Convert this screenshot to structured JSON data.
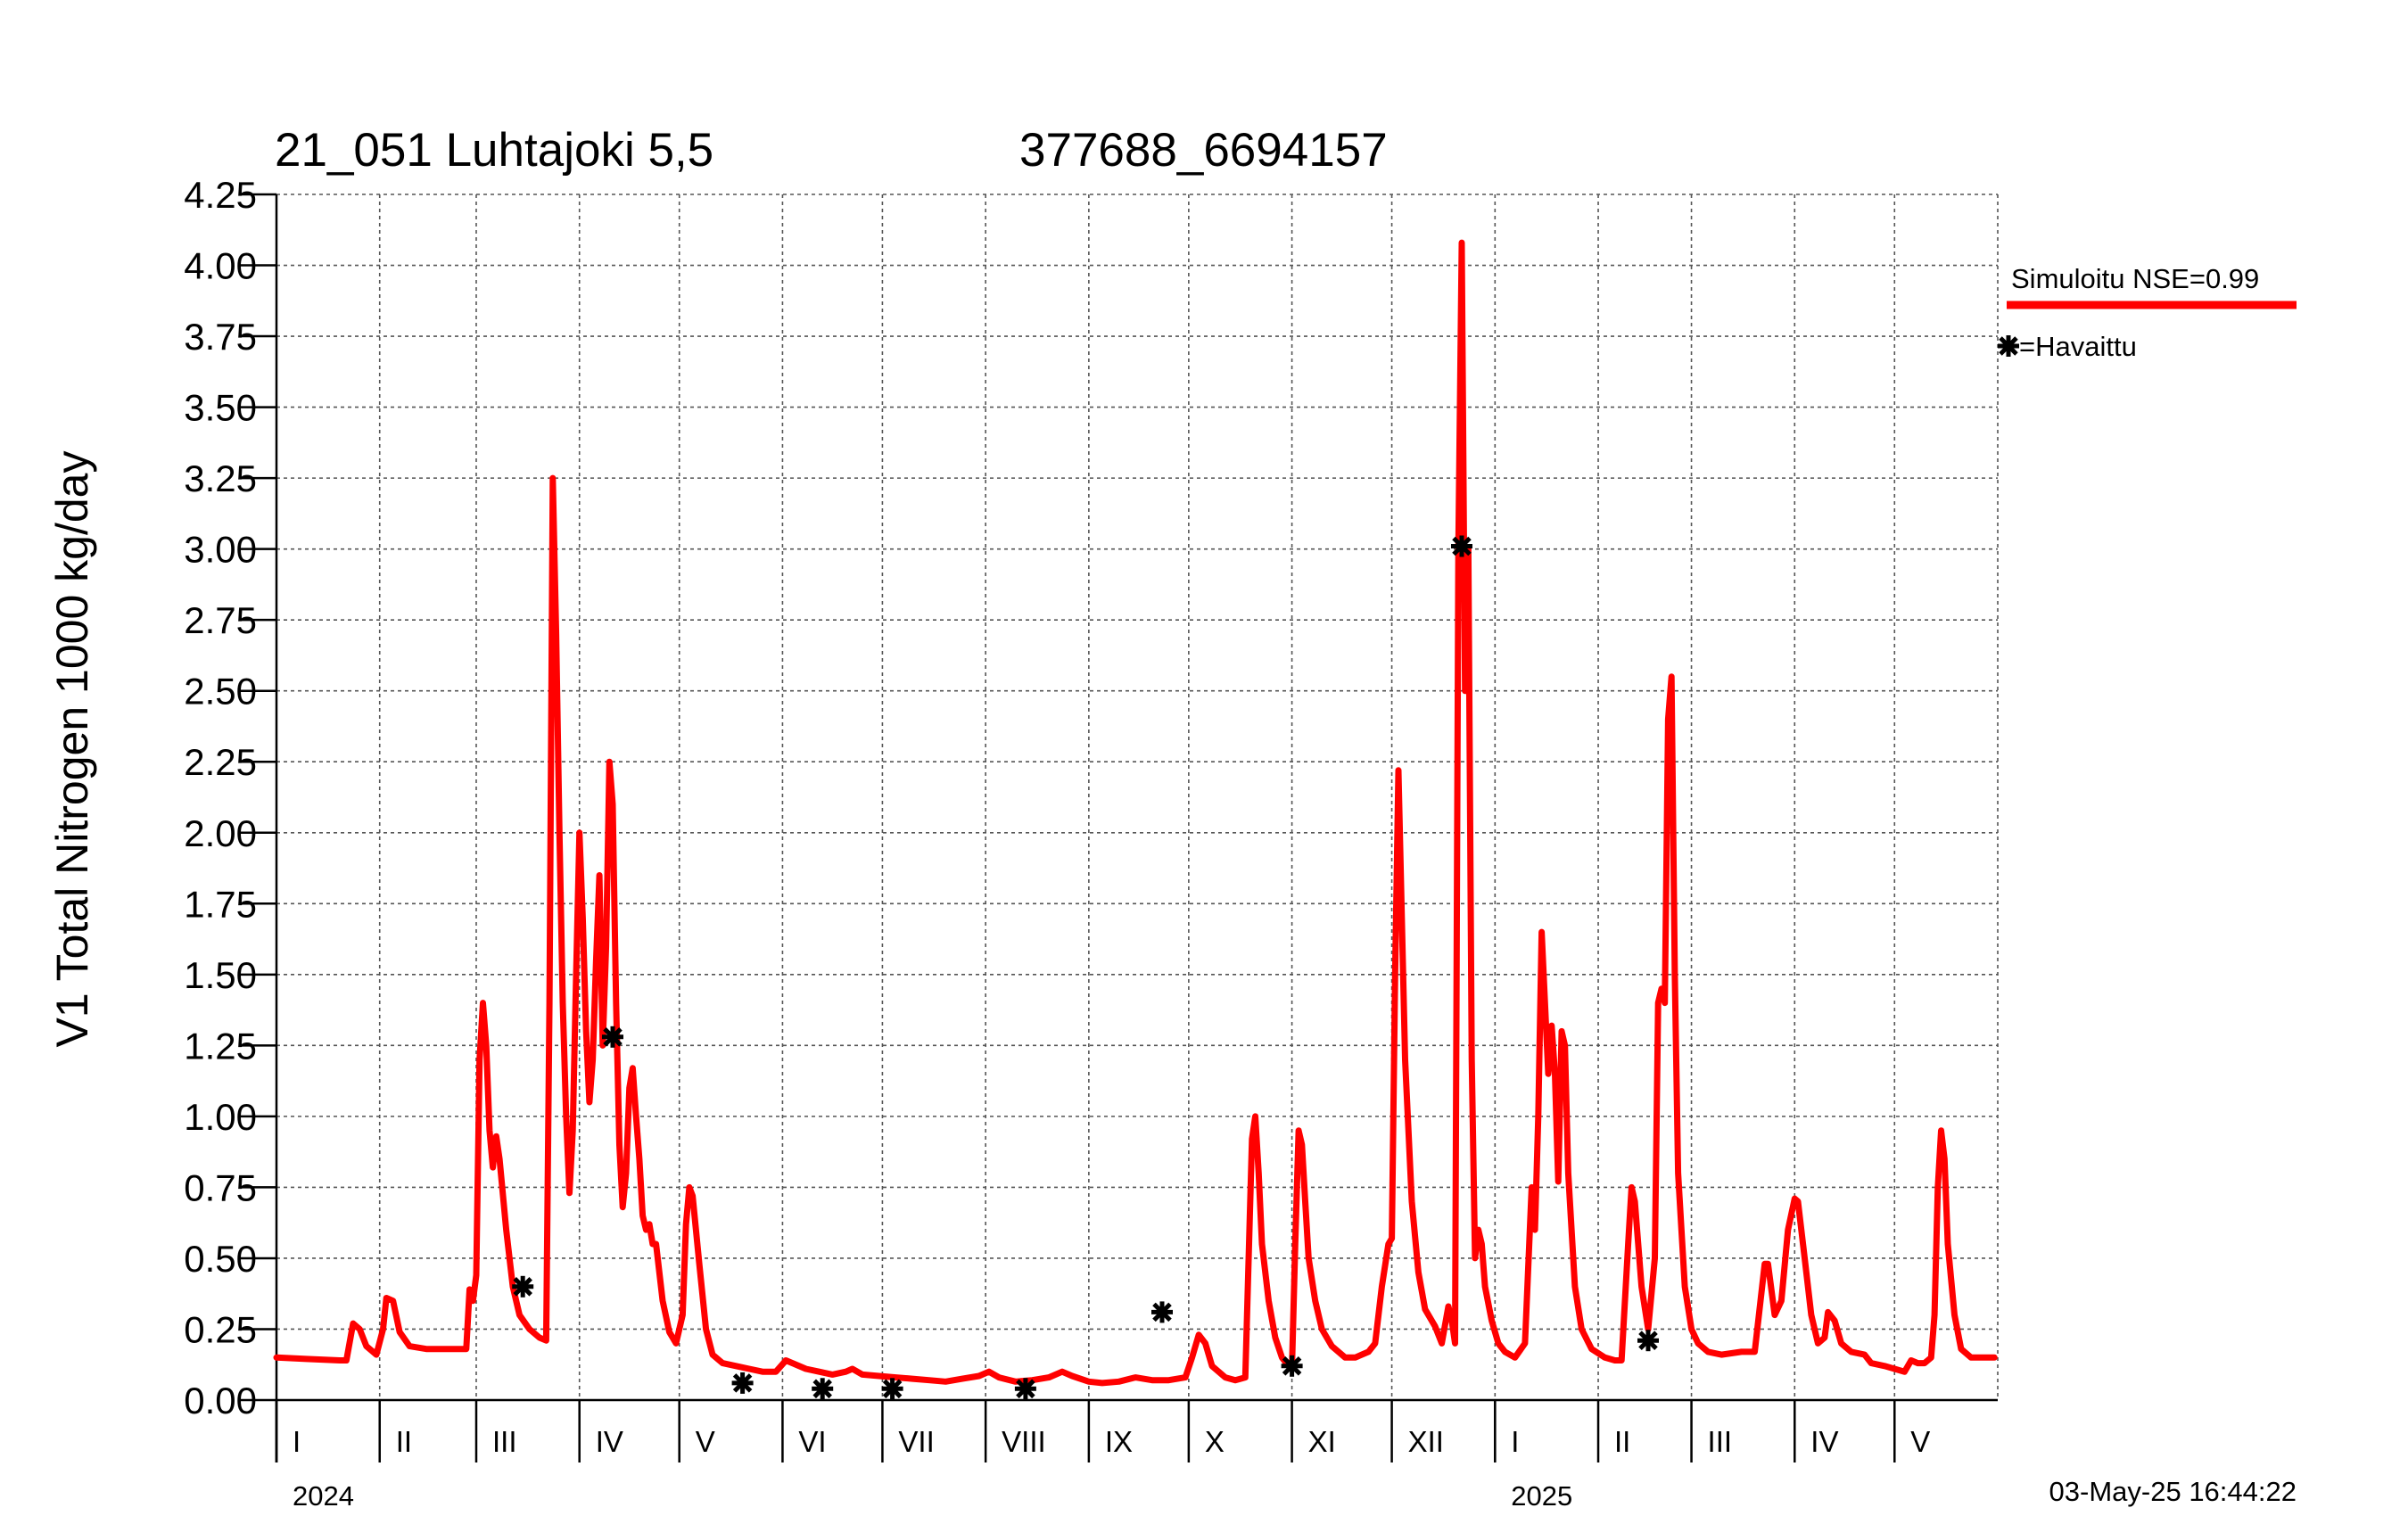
{
  "chart_data": {
    "type": "line",
    "title": "21_051 Luhtajoki 5,5",
    "subtitle": "377688_6694157",
    "ylabel": "V1 Total Nitrogen 1000 kg/day",
    "ylim": [
      0,
      4.25
    ],
    "yticks": [
      "0.00",
      "0.25",
      "0.50",
      "0.75",
      "1.00",
      "1.25",
      "1.50",
      "1.75",
      "2.00",
      "2.25",
      "2.50",
      "2.75",
      "3.00",
      "3.25",
      "3.50",
      "3.75",
      "4.00",
      "4.25"
    ],
    "xlim": [
      "2024-01-01",
      "2025-06-01"
    ],
    "x_months": [
      "2024-01-01",
      "2024-02-01",
      "2024-03-01",
      "2024-04-01",
      "2024-05-01",
      "2024-06-01",
      "2024-07-01",
      "2024-08-01",
      "2024-09-01",
      "2024-10-01",
      "2024-11-01",
      "2024-12-01",
      "2025-01-01",
      "2025-02-01",
      "2025-03-01",
      "2025-04-01",
      "2025-05-01"
    ],
    "month_labels": [
      "I",
      "II",
      "III",
      "IV",
      "V",
      "VI",
      "VII",
      "VIII",
      "IX",
      "X",
      "XI",
      "XII",
      "I",
      "II",
      "III",
      "IV",
      "V"
    ],
    "year_labels": [
      {
        "label": "2024",
        "date": "2024-01-01"
      },
      {
        "label": "2025",
        "date": "2025-01-01"
      }
    ],
    "grid": true,
    "legend": "right",
    "series": [
      {
        "name": "Simuloitu NSE=0.99",
        "style": "line",
        "color": "#ff0000",
        "points": [
          [
            "2024-01-01",
            0.15
          ],
          [
            "2024-01-10",
            0.145
          ],
          [
            "2024-01-20",
            0.14
          ],
          [
            "2024-01-22",
            0.14
          ],
          [
            "2024-01-24",
            0.27
          ],
          [
            "2024-01-26",
            0.25
          ],
          [
            "2024-01-28",
            0.19
          ],
          [
            "2024-01-31",
            0.16
          ],
          [
            "2024-02-02",
            0.25
          ],
          [
            "2024-02-03",
            0.36
          ],
          [
            "2024-02-05",
            0.35
          ],
          [
            "2024-02-07",
            0.24
          ],
          [
            "2024-02-10",
            0.19
          ],
          [
            "2024-02-15",
            0.18
          ],
          [
            "2024-02-27",
            0.18
          ],
          [
            "2024-02-28",
            0.39
          ],
          [
            "2024-02-29",
            0.35
          ],
          [
            "2024-03-01",
            0.44
          ],
          [
            "2024-03-02",
            1.2
          ],
          [
            "2024-03-03",
            1.4
          ],
          [
            "2024-03-04",
            1.25
          ],
          [
            "2024-03-05",
            0.95
          ],
          [
            "2024-03-06",
            0.82
          ],
          [
            "2024-03-07",
            0.93
          ],
          [
            "2024-03-08",
            0.85
          ],
          [
            "2024-03-10",
            0.6
          ],
          [
            "2024-03-12",
            0.4
          ],
          [
            "2024-03-14",
            0.3
          ],
          [
            "2024-03-17",
            0.25
          ],
          [
            "2024-03-20",
            0.22
          ],
          [
            "2024-03-22",
            0.21
          ],
          [
            "2024-03-23",
            1.4
          ],
          [
            "2024-03-24",
            3.25
          ],
          [
            "2024-03-25",
            2.7
          ],
          [
            "2024-03-26",
            2.0
          ],
          [
            "2024-03-27",
            1.4
          ],
          [
            "2024-03-28",
            1.0
          ],
          [
            "2024-03-29",
            0.73
          ],
          [
            "2024-03-30",
            0.95
          ],
          [
            "2024-03-31",
            1.5
          ],
          [
            "2024-04-01",
            2.0
          ],
          [
            "2024-04-02",
            1.7
          ],
          [
            "2024-04-03",
            1.3
          ],
          [
            "2024-04-04",
            1.05
          ],
          [
            "2024-04-05",
            1.2
          ],
          [
            "2024-04-06",
            1.55
          ],
          [
            "2024-04-07",
            1.85
          ],
          [
            "2024-04-08",
            1.25
          ],
          [
            "2024-04-09",
            1.6
          ],
          [
            "2024-04-10",
            2.25
          ],
          [
            "2024-04-11",
            2.1
          ],
          [
            "2024-04-12",
            1.4
          ],
          [
            "2024-04-13",
            0.9
          ],
          [
            "2024-04-14",
            0.68
          ],
          [
            "2024-04-15",
            0.8
          ],
          [
            "2024-04-16",
            1.1
          ],
          [
            "2024-04-17",
            1.17
          ],
          [
            "2024-04-18",
            1.0
          ],
          [
            "2024-04-19",
            0.85
          ],
          [
            "2024-04-20",
            0.65
          ],
          [
            "2024-04-21",
            0.6
          ],
          [
            "2024-04-22",
            0.62
          ],
          [
            "2024-04-23",
            0.55
          ],
          [
            "2024-04-24",
            0.55
          ],
          [
            "2024-04-26",
            0.35
          ],
          [
            "2024-04-28",
            0.24
          ],
          [
            "2024-04-30",
            0.2
          ],
          [
            "2024-05-02",
            0.3
          ],
          [
            "2024-05-03",
            0.62
          ],
          [
            "2024-05-04",
            0.75
          ],
          [
            "2024-05-05",
            0.72
          ],
          [
            "2024-05-07",
            0.48
          ],
          [
            "2024-05-09",
            0.25
          ],
          [
            "2024-05-11",
            0.16
          ],
          [
            "2024-05-14",
            0.13
          ],
          [
            "2024-05-18",
            0.12
          ],
          [
            "2024-05-22",
            0.11
          ],
          [
            "2024-05-26",
            0.1
          ],
          [
            "2024-05-30",
            0.1
          ],
          [
            "2024-06-02",
            0.14
          ],
          [
            "2024-06-04",
            0.13
          ],
          [
            "2024-06-08",
            0.11
          ],
          [
            "2024-06-12",
            0.1
          ],
          [
            "2024-06-16",
            0.09
          ],
          [
            "2024-06-20",
            0.1
          ],
          [
            "2024-06-22",
            0.11
          ],
          [
            "2024-06-25",
            0.09
          ],
          [
            "2024-06-30",
            0.085
          ],
          [
            "2024-07-05",
            0.08
          ],
          [
            "2024-07-10",
            0.075
          ],
          [
            "2024-07-15",
            0.07
          ],
          [
            "2024-07-20",
            0.065
          ],
          [
            "2024-07-25",
            0.075
          ],
          [
            "2024-07-30",
            0.085
          ],
          [
            "2024-08-02",
            0.1
          ],
          [
            "2024-08-05",
            0.08
          ],
          [
            "2024-08-10",
            0.065
          ],
          [
            "2024-08-15",
            0.07
          ],
          [
            "2024-08-20",
            0.08
          ],
          [
            "2024-08-24",
            0.1
          ],
          [
            "2024-08-27",
            0.085
          ],
          [
            "2024-09-01",
            0.065
          ],
          [
            "2024-09-05",
            0.06
          ],
          [
            "2024-09-10",
            0.065
          ],
          [
            "2024-09-15",
            0.08
          ],
          [
            "2024-09-20",
            0.07
          ],
          [
            "2024-09-25",
            0.07
          ],
          [
            "2024-09-30",
            0.08
          ],
          [
            "2024-10-02",
            0.15
          ],
          [
            "2024-10-04",
            0.23
          ],
          [
            "2024-10-06",
            0.2
          ],
          [
            "2024-10-08",
            0.12
          ],
          [
            "2024-10-12",
            0.08
          ],
          [
            "2024-10-15",
            0.07
          ],
          [
            "2024-10-18",
            0.08
          ],
          [
            "2024-10-20",
            0.92
          ],
          [
            "2024-10-21",
            1.0
          ],
          [
            "2024-10-22",
            0.8
          ],
          [
            "2024-10-23",
            0.55
          ],
          [
            "2024-10-25",
            0.35
          ],
          [
            "2024-10-27",
            0.22
          ],
          [
            "2024-10-29",
            0.15
          ],
          [
            "2024-10-31",
            0.12
          ],
          [
            "2024-11-01",
            0.11
          ],
          [
            "2024-11-02",
            0.55
          ],
          [
            "2024-11-03",
            0.95
          ],
          [
            "2024-11-04",
            0.9
          ],
          [
            "2024-11-05",
            0.7
          ],
          [
            "2024-11-06",
            0.5
          ],
          [
            "2024-11-08",
            0.35
          ],
          [
            "2024-11-10",
            0.25
          ],
          [
            "2024-11-13",
            0.19
          ],
          [
            "2024-11-17",
            0.15
          ],
          [
            "2024-11-20",
            0.15
          ],
          [
            "2024-11-24",
            0.17
          ],
          [
            "2024-11-26",
            0.2
          ],
          [
            "2024-11-28",
            0.4
          ],
          [
            "2024-11-30",
            0.55
          ],
          [
            "2024-12-01",
            0.57
          ],
          [
            "2024-12-02",
            1.5
          ],
          [
            "2024-12-03",
            2.22
          ],
          [
            "2024-12-04",
            1.7
          ],
          [
            "2024-12-05",
            1.2
          ],
          [
            "2024-12-07",
            0.7
          ],
          [
            "2024-12-09",
            0.45
          ],
          [
            "2024-12-11",
            0.32
          ],
          [
            "2024-12-14",
            0.26
          ],
          [
            "2024-12-16",
            0.2
          ],
          [
            "2024-12-18",
            0.33
          ],
          [
            "2024-12-19",
            0.28
          ],
          [
            "2024-12-20",
            0.2
          ],
          [
            "2024-12-21",
            3.0
          ],
          [
            "2024-12-22",
            4.08
          ],
          [
            "2024-12-23",
            2.5
          ],
          [
            "2024-12-24",
            3.0
          ],
          [
            "2024-12-25",
            1.2
          ],
          [
            "2024-12-26",
            0.5
          ],
          [
            "2024-12-27",
            0.6
          ],
          [
            "2024-12-28",
            0.55
          ],
          [
            "2024-12-29",
            0.4
          ],
          [
            "2024-12-31",
            0.28
          ],
          [
            "2025-01-02",
            0.2
          ],
          [
            "2025-01-04",
            0.17
          ],
          [
            "2025-01-07",
            0.15
          ],
          [
            "2025-01-10",
            0.2
          ],
          [
            "2025-01-12",
            0.75
          ],
          [
            "2025-01-13",
            0.6
          ],
          [
            "2025-01-14",
            1.0
          ],
          [
            "2025-01-15",
            1.65
          ],
          [
            "2025-01-16",
            1.4
          ],
          [
            "2025-01-17",
            1.15
          ],
          [
            "2025-01-18",
            1.32
          ],
          [
            "2025-01-19",
            1.15
          ],
          [
            "2025-01-20",
            0.77
          ],
          [
            "2025-01-21",
            1.3
          ],
          [
            "2025-01-22",
            1.25
          ],
          [
            "2025-01-23",
            0.8
          ],
          [
            "2025-01-25",
            0.4
          ],
          [
            "2025-01-27",
            0.25
          ],
          [
            "2025-01-30",
            0.18
          ],
          [
            "2025-02-03",
            0.15
          ],
          [
            "2025-02-06",
            0.14
          ],
          [
            "2025-02-08",
            0.14
          ],
          [
            "2025-02-10",
            0.55
          ],
          [
            "2025-02-11",
            0.75
          ],
          [
            "2025-02-12",
            0.7
          ],
          [
            "2025-02-14",
            0.4
          ],
          [
            "2025-02-16",
            0.25
          ],
          [
            "2025-02-18",
            0.5
          ],
          [
            "2025-02-19",
            1.4
          ],
          [
            "2025-02-20",
            1.45
          ],
          [
            "2025-02-21",
            1.4
          ],
          [
            "2025-02-22",
            2.4
          ],
          [
            "2025-02-23",
            2.55
          ],
          [
            "2025-02-24",
            1.5
          ],
          [
            "2025-02-25",
            0.8
          ],
          [
            "2025-02-27",
            0.4
          ],
          [
            "2025-03-01",
            0.25
          ],
          [
            "2025-03-03",
            0.2
          ],
          [
            "2025-03-06",
            0.17
          ],
          [
            "2025-03-10",
            0.16
          ],
          [
            "2025-03-16",
            0.17
          ],
          [
            "2025-03-20",
            0.17
          ],
          [
            "2025-03-23",
            0.48
          ],
          [
            "2025-03-24",
            0.48
          ],
          [
            "2025-03-26",
            0.3
          ],
          [
            "2025-03-28",
            0.35
          ],
          [
            "2025-03-30",
            0.6
          ],
          [
            "2025-04-01",
            0.71
          ],
          [
            "2025-04-02",
            0.7
          ],
          [
            "2025-04-04",
            0.5
          ],
          [
            "2025-04-06",
            0.3
          ],
          [
            "2025-04-08",
            0.2
          ],
          [
            "2025-04-10",
            0.22
          ],
          [
            "2025-04-11",
            0.31
          ],
          [
            "2025-04-13",
            0.28
          ],
          [
            "2025-04-15",
            0.2
          ],
          [
            "2025-04-18",
            0.17
          ],
          [
            "2025-04-22",
            0.16
          ],
          [
            "2025-04-24",
            0.13
          ],
          [
            "2025-04-28",
            0.12
          ],
          [
            "2025-05-01",
            0.11
          ],
          [
            "2025-05-04",
            0.1
          ],
          [
            "2025-05-06",
            0.14
          ],
          [
            "2025-05-08",
            0.13
          ],
          [
            "2025-05-10",
            0.13
          ],
          [
            "2025-05-12",
            0.15
          ],
          [
            "2025-05-13",
            0.3
          ],
          [
            "2025-05-14",
            0.75
          ],
          [
            "2025-05-15",
            0.95
          ],
          [
            "2025-05-16",
            0.85
          ],
          [
            "2025-05-17",
            0.55
          ],
          [
            "2025-05-19",
            0.3
          ],
          [
            "2025-05-21",
            0.18
          ],
          [
            "2025-05-24",
            0.15
          ],
          [
            "2025-05-28",
            0.15
          ],
          [
            "2025-05-31",
            0.15
          ]
        ]
      },
      {
        "name": "Havaittu",
        "style": "marker",
        "color": "#000000",
        "points": [
          [
            "2024-03-15",
            0.4
          ],
          [
            "2024-04-11",
            1.28
          ],
          [
            "2024-05-20",
            0.06
          ],
          [
            "2024-06-13",
            0.04
          ],
          [
            "2024-07-04",
            0.04
          ],
          [
            "2024-08-13",
            0.04
          ],
          [
            "2024-09-23",
            0.31
          ],
          [
            "2024-11-01",
            0.12
          ],
          [
            "2024-12-22",
            3.01
          ],
          [
            "2025-02-16",
            0.21
          ]
        ]
      }
    ]
  },
  "legend_items": {
    "sim_label": "Simuloitu NSE=0.99",
    "obs_label": "=Havaittu"
  },
  "timestamp": "03-May-25 16:44:22"
}
